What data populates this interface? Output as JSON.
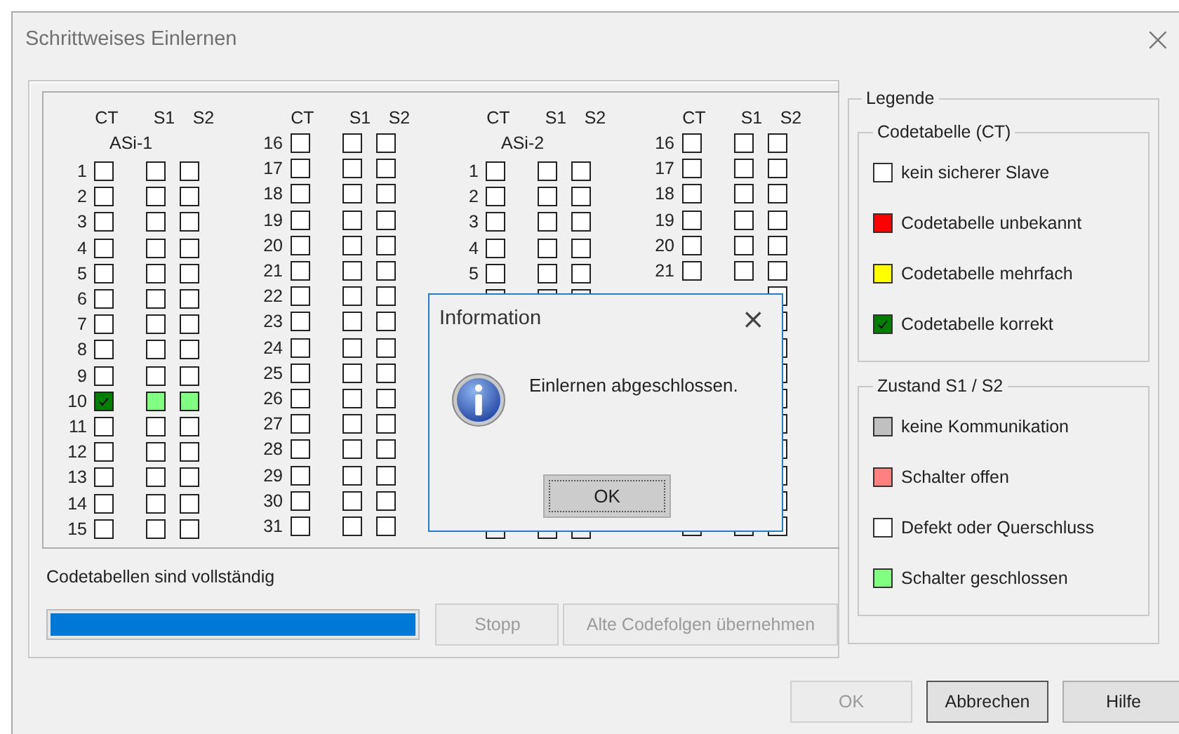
{
  "window": {
    "title": "Schrittweises Einlernen",
    "close": "×"
  },
  "grid": {
    "blocks": [
      {
        "headers": [
          "CT",
          "S1",
          "S2"
        ],
        "subtitle": "ASi-1",
        "rows": [
          {
            "label": "1",
            "ct_correct": false,
            "s1_closed": false,
            "s2_closed": false
          },
          {
            "label": "2",
            "ct_correct": false,
            "s1_closed": false,
            "s2_closed": false
          },
          {
            "label": "3",
            "ct_correct": false,
            "s1_closed": false,
            "s2_closed": false
          },
          {
            "label": "4",
            "ct_correct": false,
            "s1_closed": false,
            "s2_closed": false
          },
          {
            "label": "5",
            "ct_correct": false,
            "s1_closed": false,
            "s2_closed": false
          },
          {
            "label": "6",
            "ct_correct": false,
            "s1_closed": false,
            "s2_closed": false
          },
          {
            "label": "7",
            "ct_correct": false,
            "s1_closed": false,
            "s2_closed": false
          },
          {
            "label": "8",
            "ct_correct": false,
            "s1_closed": false,
            "s2_closed": false
          },
          {
            "label": "9",
            "ct_correct": false,
            "s1_closed": false,
            "s2_closed": false
          },
          {
            "label": "10",
            "ct_correct": true,
            "s1_closed": true,
            "s2_closed": true
          },
          {
            "label": "11",
            "ct_correct": false,
            "s1_closed": false,
            "s2_closed": false
          },
          {
            "label": "12",
            "ct_correct": false,
            "s1_closed": false,
            "s2_closed": false
          },
          {
            "label": "13",
            "ct_correct": false,
            "s1_closed": false,
            "s2_closed": false
          },
          {
            "label": "14",
            "ct_correct": false,
            "s1_closed": false,
            "s2_closed": false
          },
          {
            "label": "15",
            "ct_correct": false,
            "s1_closed": false,
            "s2_closed": false
          }
        ]
      },
      {
        "headers": [
          "CT",
          "S1",
          "S2"
        ],
        "rows": [
          {
            "label": "16",
            "ct_correct": false,
            "s1_closed": false,
            "s2_closed": false
          },
          {
            "label": "17",
            "ct_correct": false,
            "s1_closed": false,
            "s2_closed": false
          },
          {
            "label": "18",
            "ct_correct": false,
            "s1_closed": false,
            "s2_closed": false
          },
          {
            "label": "19",
            "ct_correct": false,
            "s1_closed": false,
            "s2_closed": false
          },
          {
            "label": "20",
            "ct_correct": false,
            "s1_closed": false,
            "s2_closed": false
          },
          {
            "label": "21",
            "ct_correct": false,
            "s1_closed": false,
            "s2_closed": false
          },
          {
            "label": "22",
            "ct_correct": false,
            "s1_closed": false,
            "s2_closed": false
          },
          {
            "label": "23",
            "ct_correct": false,
            "s1_closed": false,
            "s2_closed": false
          },
          {
            "label": "24",
            "ct_correct": false,
            "s1_closed": false,
            "s2_closed": false
          },
          {
            "label": "25",
            "ct_correct": false,
            "s1_closed": false,
            "s2_closed": false
          },
          {
            "label": "26",
            "ct_correct": false,
            "s1_closed": false,
            "s2_closed": false
          },
          {
            "label": "27",
            "ct_correct": false,
            "s1_closed": false,
            "s2_closed": false
          },
          {
            "label": "28",
            "ct_correct": false,
            "s1_closed": false,
            "s2_closed": false
          },
          {
            "label": "29",
            "ct_correct": false,
            "s1_closed": false,
            "s2_closed": false
          },
          {
            "label": "30",
            "ct_correct": false,
            "s1_closed": false,
            "s2_closed": false
          },
          {
            "label": "31",
            "ct_correct": false,
            "s1_closed": false,
            "s2_closed": false
          }
        ]
      },
      {
        "headers": [
          "CT",
          "S1",
          "S2"
        ],
        "subtitle": "ASi-2",
        "rows": [
          {
            "label": "1",
            "ct_correct": false,
            "s1_closed": false,
            "s2_closed": false
          },
          {
            "label": "2",
            "ct_correct": false,
            "s1_closed": false,
            "s2_closed": false
          },
          {
            "label": "3",
            "ct_correct": false,
            "s1_closed": false,
            "s2_closed": false
          },
          {
            "label": "4",
            "ct_correct": false,
            "s1_closed": false,
            "s2_closed": false
          },
          {
            "label": "5",
            "ct_correct": false,
            "s1_closed": false,
            "s2_closed": false
          },
          {
            "covered": true
          },
          {},
          {},
          {},
          {},
          {},
          {},
          {},
          {},
          {
            "covered": true
          }
        ]
      },
      {
        "headers": [
          "CT",
          "S1",
          "S2"
        ],
        "rows": [
          {
            "label": "16",
            "ct_correct": false,
            "s1_closed": false,
            "s2_closed": false
          },
          {
            "label": "17",
            "ct_correct": false,
            "s1_closed": false,
            "s2_closed": false
          },
          {
            "label": "18",
            "ct_correct": false,
            "s1_closed": false,
            "s2_closed": false
          },
          {
            "label": "19",
            "ct_correct": false,
            "s1_closed": false,
            "s2_closed": false
          },
          {
            "label": "20",
            "ct_correct": false,
            "s1_closed": false,
            "s2_closed": false
          },
          {
            "label": "21",
            "ct_correct": false,
            "s1_closed": false,
            "s2_closed": false
          },
          {
            "s2_closed": false
          },
          {
            "s2_closed": false
          },
          {
            "s2_closed": false
          },
          {
            "s2_closed": false
          },
          {
            "s2_closed": false
          },
          {
            "s2_closed": false
          },
          {
            "s2_closed": false
          },
          {
            "s2_closed": false
          },
          {
            "s2_closed": false
          },
          {
            "covered": true,
            "s2_closed": false
          }
        ]
      }
    ]
  },
  "status_text": "Codetabellen sind vollständig",
  "progress": {
    "level": 1
  },
  "actions": [
    {
      "label": "Stopp",
      "disabled": true
    },
    {
      "label": "Alte Codefolgen übernehmen",
      "disabled": true
    }
  ],
  "legend": {
    "title": "Legende",
    "groups": [
      {
        "title": "Codetabelle (CT)",
        "items": [
          {
            "label": "kein sicherer Slave",
            "color": "#ffffff",
            "checked": false
          },
          {
            "label": "Codetabelle unbekannt",
            "color": "#ff0000",
            "checked": false
          },
          {
            "label": "Codetabelle mehrfach",
            "color": "#ffff00",
            "checked": false
          },
          {
            "label": "Codetabelle korrekt",
            "color": "#008000",
            "checked": true
          }
        ]
      },
      {
        "title": "Zustand S1 / S2",
        "items": [
          {
            "label": "keine Kommunikation",
            "color": "#c0c0c0",
            "checked": false
          },
          {
            "label": "Schalter offen",
            "color": "#ff8080",
            "checked": false
          },
          {
            "label": "Defekt oder Querschluss",
            "color": "#ffffff",
            "checked": false
          },
          {
            "label": "Schalter geschlossen",
            "color": "#80ff80",
            "checked": false
          }
        ]
      }
    ]
  },
  "buttons": [
    {
      "label": "OK",
      "disabled": true,
      "default": false
    },
    {
      "label": "Abbrechen",
      "disabled": false,
      "default": true
    },
    {
      "label": "Hilfe",
      "disabled": false,
      "default": false
    }
  ],
  "message_box": {
    "title": "Information",
    "close": "×",
    "message": "Einlernen abgeschlossen.",
    "button": "OK"
  }
}
